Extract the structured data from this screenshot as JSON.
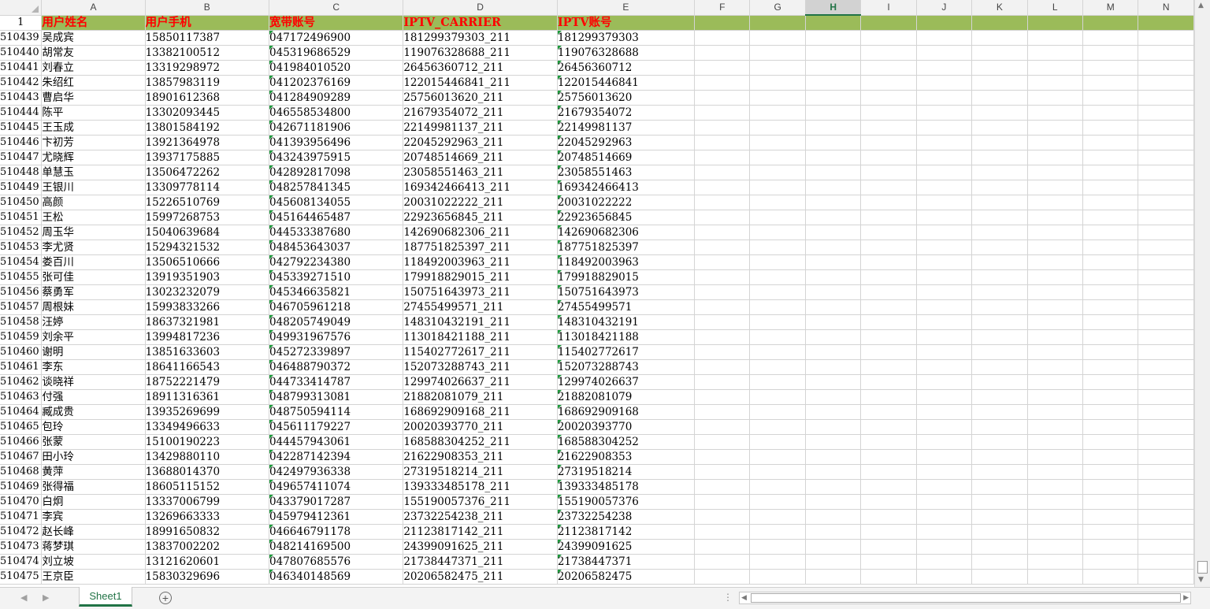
{
  "columns": [
    "A",
    "B",
    "C",
    "D",
    "E",
    "F",
    "G",
    "H",
    "I",
    "J",
    "K",
    "L",
    "M",
    "N"
  ],
  "active_column": "H",
  "header_row_number": "1",
  "header": [
    "用户姓名",
    "用户手机",
    "宽带账号",
    "IPTV_CARRIER",
    "IPTV账号"
  ],
  "rows": [
    [
      "510439",
      "吴成宾",
      "15850117387",
      "047172496900",
      "181299379303_211",
      "181299379303"
    ],
    [
      "510440",
      "胡常友",
      "13382100512",
      "045319686529",
      "119076328688_211",
      "119076328688"
    ],
    [
      "510441",
      "刘春立",
      "13319298972",
      "041984010520",
      "26456360712_211",
      "26456360712"
    ],
    [
      "510442",
      "朱绍红",
      "13857983119",
      "041202376169",
      "122015446841_211",
      "122015446841"
    ],
    [
      "510443",
      "曹启华",
      "18901612368",
      "041284909289",
      "25756013620_211",
      "25756013620"
    ],
    [
      "510444",
      "陈平",
      "13302093445",
      "046558534800",
      "21679354072_211",
      "21679354072"
    ],
    [
      "510445",
      "王玉成",
      "13801584192",
      "042671181906",
      "22149981137_211",
      "22149981137"
    ],
    [
      "510446",
      "卞初芳",
      "13921364978",
      "041393956496",
      "22045292963_211",
      "22045292963"
    ],
    [
      "510447",
      "尤晓辉",
      "13937175885",
      "043243975915",
      "20748514669_211",
      "20748514669"
    ],
    [
      "510448",
      "单慧玉",
      "13506472262",
      "042892817098",
      "23058551463_211",
      "23058551463"
    ],
    [
      "510449",
      "王银川",
      "13309778114",
      "048257841345",
      "169342466413_211",
      "169342466413"
    ],
    [
      "510450",
      "高颜",
      "15226510769",
      "045608134055",
      "20031022222_211",
      "20031022222"
    ],
    [
      "510451",
      "王松",
      "15997268753",
      "045164465487",
      "22923656845_211",
      "22923656845"
    ],
    [
      "510452",
      "周玉华",
      "15040639684",
      "044533387680",
      "142690682306_211",
      "142690682306"
    ],
    [
      "510453",
      "李尤贤",
      "15294321532",
      "048453643037",
      "187751825397_211",
      "187751825397"
    ],
    [
      "510454",
      "娄百川",
      "13506510666",
      "042792234380",
      "118492003963_211",
      "118492003963"
    ],
    [
      "510455",
      "张可佳",
      "13919351903",
      "045339271510",
      "179918829015_211",
      "179918829015"
    ],
    [
      "510456",
      "蔡勇军",
      "13023232079",
      "045346635821",
      "150751643973_211",
      "150751643973"
    ],
    [
      "510457",
      "周根妹",
      "15993833266",
      "046705961218",
      "27455499571_211",
      "27455499571"
    ],
    [
      "510458",
      "汪婷",
      "18637321981",
      "048205749049",
      "148310432191_211",
      "148310432191"
    ],
    [
      "510459",
      "刘余平",
      "13994817236",
      "049931967576",
      "113018421188_211",
      "113018421188"
    ],
    [
      "510460",
      "谢明",
      "13851633603",
      "045272339897",
      "115402772617_211",
      "115402772617"
    ],
    [
      "510461",
      "李东",
      "18641166543",
      "046488790372",
      "152073288743_211",
      "152073288743"
    ],
    [
      "510462",
      "谈晓祥",
      "18752221479",
      "044733414787",
      "129974026637_211",
      "129974026637"
    ],
    [
      "510463",
      "付强",
      "18911316361",
      "048799313081",
      "21882081079_211",
      "21882081079"
    ],
    [
      "510464",
      "臧成贵",
      "13935269699",
      "048750594114",
      "168692909168_211",
      "168692909168"
    ],
    [
      "510465",
      "包玲",
      "13349496633",
      "045611179227",
      "20020393770_211",
      "20020393770"
    ],
    [
      "510466",
      "张蒙",
      "15100190223",
      "044457943061",
      "168588304252_211",
      "168588304252"
    ],
    [
      "510467",
      "田小玲",
      "13429880110",
      "042287142394",
      "21622908353_211",
      "21622908353"
    ],
    [
      "510468",
      "黄萍",
      "13688014370",
      "042497936338",
      "27319518214_211",
      "27319518214"
    ],
    [
      "510469",
      "张得福",
      "18605115152",
      "049657411074",
      "139333485178_211",
      "139333485178"
    ],
    [
      "510470",
      "白炯",
      "13337006799",
      "043379017287",
      "155190057376_211",
      "155190057376"
    ],
    [
      "510471",
      "李宾",
      "13269663333",
      "045979412361",
      "23732254238_211",
      "23732254238"
    ],
    [
      "510472",
      "赵长峰",
      "18991650832",
      "046646791178",
      "21123817142_211",
      "21123817142"
    ],
    [
      "510473",
      "蒋梦琪",
      "13837002202",
      "048214169500",
      "24399091625_211",
      "24399091625"
    ],
    [
      "510474",
      "刘立坡",
      "13121620601",
      "047807685576",
      "21738447371_211",
      "21738447371"
    ],
    [
      "510475",
      "王京臣",
      "15830329696",
      "046340148569",
      "20206582475_211",
      "20206582475"
    ]
  ],
  "tabbar": {
    "sheet_tab": "Sheet1",
    "add_sheet": "+",
    "dots": "⋮"
  },
  "colors": {
    "header_fill": "#9bbb59",
    "header_text": "#ff0000",
    "accent": "#217346"
  }
}
